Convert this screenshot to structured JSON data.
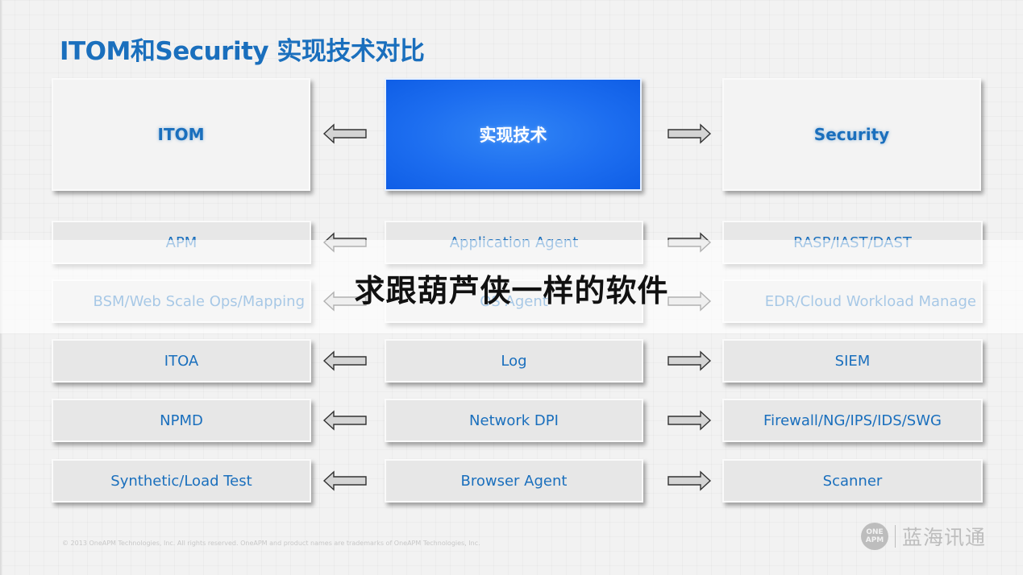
{
  "slide": {
    "title": "ITOM和Security 实现技术对比",
    "headers": {
      "left": "ITOM",
      "center": "实现技术",
      "right": "Security"
    },
    "rows": [
      {
        "itom": "APM",
        "tech": "Application Agent",
        "security": "RASP/IAST/DAST"
      },
      {
        "itom": "BSM/Web Scale Ops/Mapping",
        "tech": "OS Agent",
        "security": "EDR/Cloud Workload Manage"
      },
      {
        "itom": "ITOA",
        "tech": "Log",
        "security": "SIEM"
      },
      {
        "itom": "NPMD",
        "tech": "Network DPI",
        "security": "Firewall/NG/IPS/IDS/SWG"
      },
      {
        "itom": "Synthetic/Load Test",
        "tech": "Browser Agent",
        "security": "Scanner"
      }
    ],
    "arrows": {
      "left_icon": "arrow-left-icon",
      "right_icon": "arrow-right-icon"
    },
    "footer": {
      "copyright": "© 2013 OneAPM Technologies, Inc.  All rights reserved. OneAPM and  product names are trademarks of OneAPM Technologies, Inc.",
      "logo_line1": "ONE",
      "logo_line2": "APM",
      "brand_name": "蓝海讯通"
    }
  },
  "overlay": {
    "caption": "求跟葫芦侠一样的软件"
  },
  "colors": {
    "title_blue": "#1a6fbd",
    "center_box_blue": "#1d6ef0",
    "box_gray": "#e7e7e7",
    "overlay_text": "#111111"
  }
}
